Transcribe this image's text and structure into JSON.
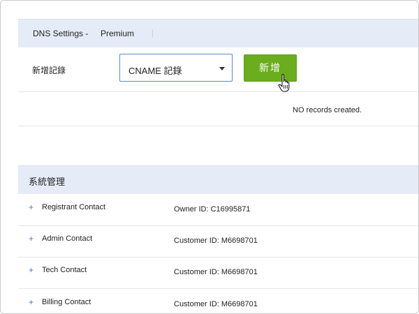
{
  "dns": {
    "title": "DNS Settings -",
    "plan": "Premium"
  },
  "add_record": {
    "label": "新增記錄",
    "selected_type": "CNAME 記錄",
    "button_label": "新增"
  },
  "records": {
    "empty_message": "NO records created."
  },
  "system": {
    "title": "系統管理",
    "contacts": [
      {
        "label": "Registrant Contact",
        "id_text": "Owner ID: C16995871",
        "expand": "+"
      },
      {
        "label": "Admin Contact",
        "id_text": "Customer ID: M6698701",
        "expand": "+"
      },
      {
        "label": "Tech Contact",
        "id_text": "Customer ID: M6698701",
        "expand": "+"
      },
      {
        "label": "Billing Contact",
        "id_text": "Customer ID: M6698701",
        "expand": "+"
      }
    ]
  },
  "colors": {
    "header_bg": "#e5ecf7",
    "button_green": "#6aad1e",
    "select_border": "#5b8ac7",
    "plus_blue": "#4a78b8"
  },
  "icons": {
    "cursor": "hand-pointer-icon",
    "dropdown": "chevron-down-icon",
    "expand": "plus-icon"
  }
}
